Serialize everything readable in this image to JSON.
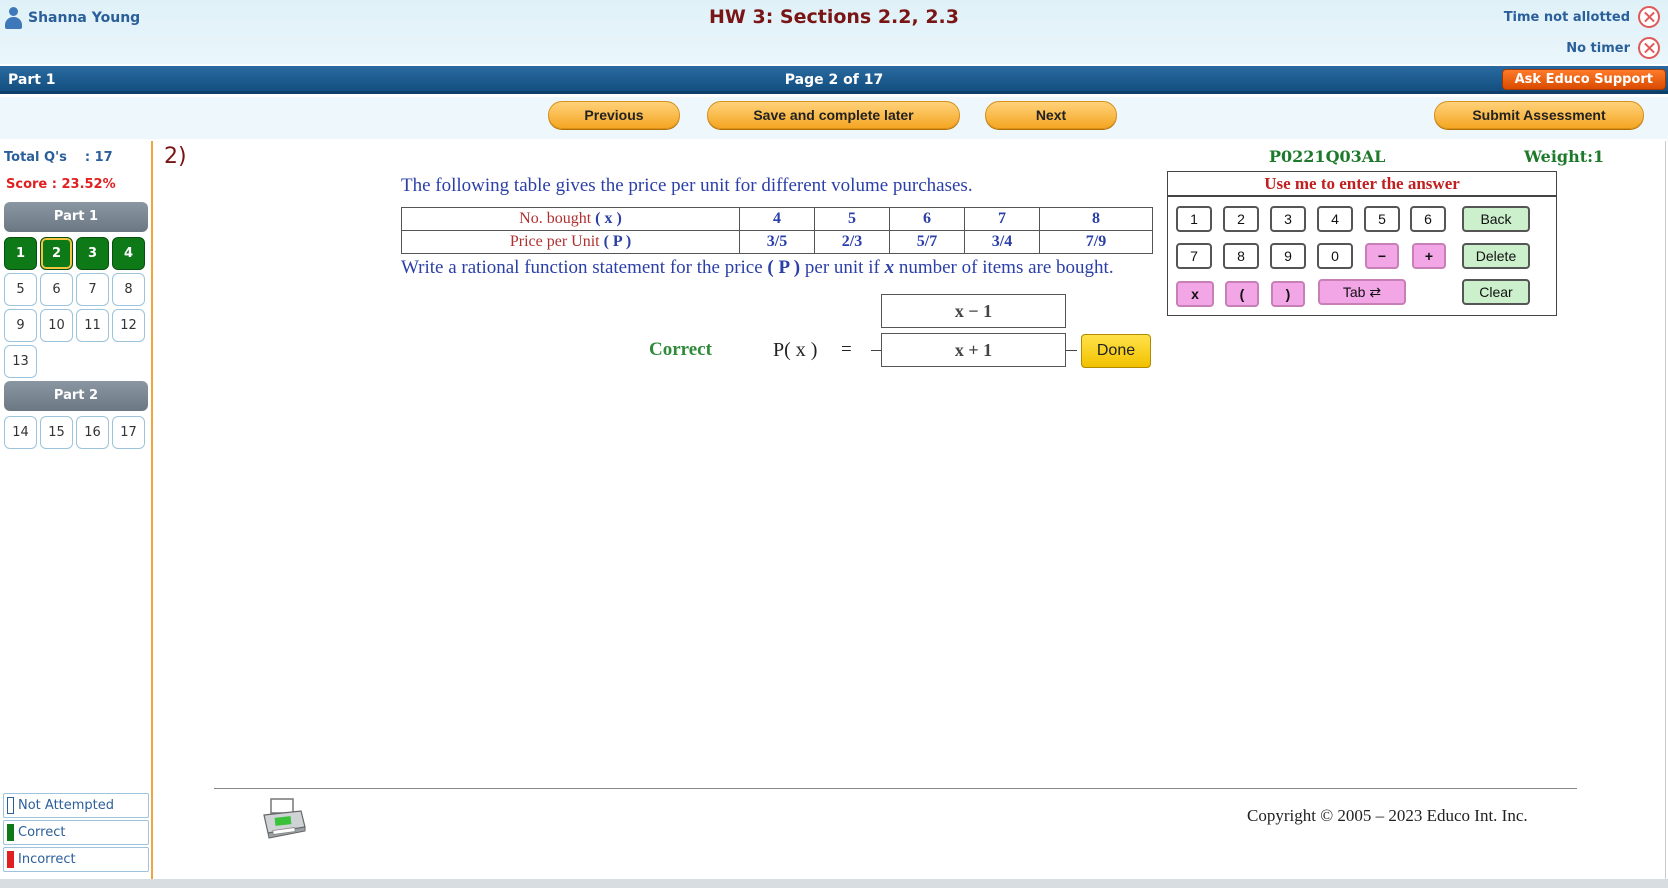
{
  "header": {
    "user_name": "Shanna Young",
    "title": "HW 3: Sections 2.2, 2.3",
    "time_status": "Time not allotted",
    "timer_status": "No timer",
    "part_label": "Part 1",
    "page_label": "Page 2 of 17",
    "support_label": "Ask Educo Support"
  },
  "nav": {
    "previous": "Previous",
    "save": "Save and complete later",
    "next": "Next",
    "submit": "Submit Assessment"
  },
  "sidebar": {
    "total_label": "Total Q's    : 17",
    "score_label": "Score : 23.52%",
    "part1": "Part 1",
    "part2": "Part 2",
    "part1_questions": [
      {
        "n": "1",
        "status": "correct"
      },
      {
        "n": "2",
        "status": "correct"
      },
      {
        "n": "3",
        "status": "correct"
      },
      {
        "n": "4",
        "status": "correct"
      },
      {
        "n": "5",
        "status": "not-attempted"
      },
      {
        "n": "6",
        "status": "not-attempted"
      },
      {
        "n": "7",
        "status": "not-attempted"
      },
      {
        "n": "8",
        "status": "not-attempted"
      },
      {
        "n": "9",
        "status": "not-attempted"
      },
      {
        "n": "10",
        "status": "not-attempted"
      },
      {
        "n": "11",
        "status": "not-attempted"
      },
      {
        "n": "12",
        "status": "not-attempted"
      },
      {
        "n": "13",
        "status": "not-attempted"
      }
    ],
    "part2_questions": [
      {
        "n": "14",
        "status": "not-attempted"
      },
      {
        "n": "15",
        "status": "not-attempted"
      },
      {
        "n": "16",
        "status": "not-attempted"
      },
      {
        "n": "17",
        "status": "not-attempted"
      }
    ],
    "legend": {
      "not_attempted": "Not Attempted",
      "correct": "Correct",
      "incorrect": "Incorrect"
    },
    "colors": {
      "correct": "#0d7a17",
      "incorrect": "#e02020",
      "not_attempted": "#ffffff"
    }
  },
  "question": {
    "number": "2)",
    "id": "P0221Q03AL",
    "weight": "Weight:1",
    "intro": "The following table gives the price per unit for different volume purchases.",
    "row1_label_pre": "No. bought ",
    "row1_var": "( x )",
    "row2_label_pre": "Price per Unit ",
    "row2_var": "( P )",
    "x_values": [
      "4",
      "5",
      "6",
      "7",
      "8"
    ],
    "p_values": [
      "3/5",
      "2/3",
      "5/7",
      "3/4",
      "7/9"
    ],
    "prompt_pre": "Write a rational function statement for the price ",
    "prompt_var_p": "( P )",
    "prompt_mid": " per unit if ",
    "prompt_var_x": "x",
    "prompt_post": " number of items are bought."
  },
  "answer": {
    "status": "Correct",
    "func": "P( x )",
    "equals": "=",
    "numerator": "x − 1",
    "denominator": "x + 1",
    "done_label": "Done"
  },
  "keypad": {
    "title": "Use me to enter the answer",
    "row1": [
      "1",
      "2",
      "3",
      "4",
      "5",
      "6"
    ],
    "row2": [
      "7",
      "8",
      "9",
      "0"
    ],
    "minus": "−",
    "plus": "+",
    "x": "x",
    "lparen": "(",
    "rparen": ")",
    "tab": "Tab ⇄",
    "back": "Back",
    "delete": "Delete",
    "clear": "Clear"
  },
  "footer": {
    "copyright": "Copyright © 2005 – 2023 Educo Int. Inc."
  }
}
